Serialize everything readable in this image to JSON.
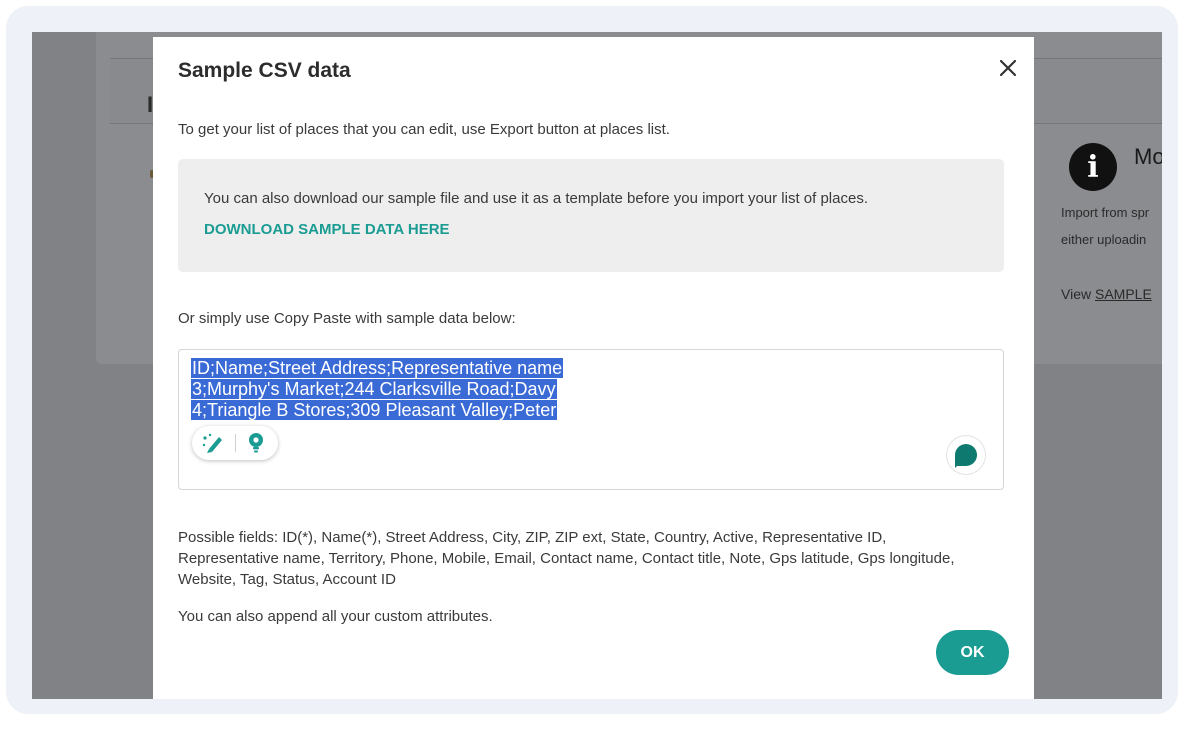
{
  "background": {
    "tab_letter": "I",
    "info_icon_glyph": "i",
    "info_title": "Mo",
    "info_line1": "Import from spr",
    "info_line2": "either uploadin",
    "view_prefix": "View",
    "view_link": "SAMPLE"
  },
  "modal": {
    "title": "Sample CSV data",
    "close_glyph": "close-icon",
    "intro": "To get your list of places that you can edit, use Export button at places list.",
    "info_box": {
      "text": "You can also download our sample file and use it as a template before you import your list of places.",
      "download_link": "DOWNLOAD SAMPLE DATA HERE"
    },
    "paste_label": "Or simply use Copy Paste with sample data below:",
    "sample_lines": [
      "ID;Name;Street Address;Representative name",
      "3;Murphy's Market;244 Clarksville Road;Davy",
      "4;Triangle B Stores;309 Pleasant Valley;Peter"
    ],
    "fields_text": "Possible fields: ID(*), Name(*), Street Address, City, ZIP, ZIP ext, State, Country, Active, Representative ID, Representative name, Territory, Phone, Mobile, Email, Contact name, Contact title, Note, Gps latitude, Gps longitude, Website, Tag, Status, Account ID",
    "custom_text": "You can also append all your custom attributes.",
    "ok_label": "OK"
  },
  "colors": {
    "accent": "#1a9c93",
    "selection": "#3a6ad6",
    "overlay": "#808285"
  }
}
